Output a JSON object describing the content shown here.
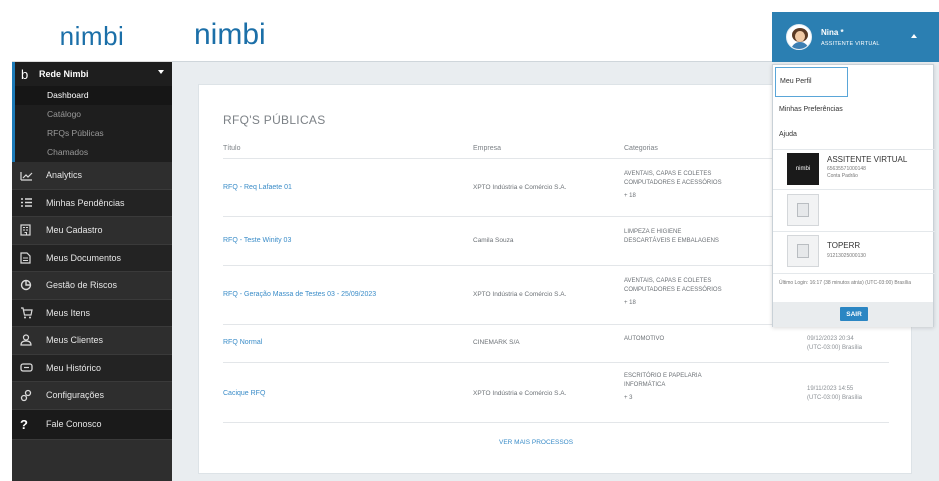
{
  "sidebar": {
    "logo_text": "nimbi",
    "group": {
      "label": "Rede Nimbi",
      "icon": "nimbi-b-icon"
    },
    "subitems": [
      "Dashboard",
      "Catálogo",
      "RFQs Públicas",
      "Chamados"
    ],
    "items": [
      {
        "label": "Analytics",
        "icon": "analytics-chart-icon"
      },
      {
        "label": "Minhas Pendências",
        "icon": "list-checks-icon"
      },
      {
        "label": "Meu Cadastro",
        "icon": "building-icon"
      },
      {
        "label": "Meus Documentos",
        "icon": "document-icon"
      },
      {
        "label": "Gestão de Riscos",
        "icon": "risk-icon"
      },
      {
        "label": "Meus Itens",
        "icon": "cart-icon"
      },
      {
        "label": "Meus Clientes",
        "icon": "users-icon"
      },
      {
        "label": "Meu Histórico",
        "icon": "history-icon"
      },
      {
        "label": "Configurações",
        "icon": "gears-icon"
      },
      {
        "label": "Fale Conosco",
        "icon": "question-icon"
      }
    ]
  },
  "header": {
    "logo_text": "nimbi",
    "user": {
      "name": "Nina *",
      "role": "ASSITENTE VIRTUAL"
    }
  },
  "main": {
    "title": "RFQ'S PÚBLICAS",
    "columns": [
      "Título",
      "Empresa",
      "Categorias"
    ],
    "rows": [
      {
        "title": "RFQ - Req Lafaete 01",
        "empresa": "XPTO Indústria e Comércio S.A.",
        "categorias": [
          "AVENTAIS, CAPAS E COLETES",
          "COMPUTADORES E ACESSÓRIOS",
          "+ 18"
        ],
        "date": ""
      },
      {
        "title": "RFQ - Teste Winity 03",
        "empresa": "Camila Souza",
        "categorias": [
          "LIMPEZA E HIGIENE",
          "DESCARTÁVEIS E EMBALAGENS"
        ],
        "date": ""
      },
      {
        "title": "RFQ - Geração Massa de Testes 03 - 25/09/2023",
        "empresa": "XPTO Indústria e Comércio S.A.",
        "categorias": [
          "AVENTAIS, CAPAS E COLETES",
          "COMPUTADORES E ACESSÓRIOS",
          "+ 18"
        ],
        "date": ""
      },
      {
        "title": "RFQ Normal",
        "empresa": "CINEMARK S/A",
        "categorias": [
          "AUTOMOTIVO"
        ],
        "date": "09/12/2023 20:34",
        "tz": "(UTC-03:00) Brasília"
      },
      {
        "title": "Cacique RFQ",
        "empresa": "XPTO Indústria e Comércio S.A.",
        "categorias": [
          "ESCRITÓRIO E PAPELARIA",
          "INFORMÁTICA",
          "+ 3"
        ],
        "date": "19/11/2023 14:55",
        "tz": "(UTC-03:00) Brasília"
      }
    ],
    "ver_mais": "VER MAIS PROCESSOS"
  },
  "dropdown": {
    "items": [
      "Meu Perfil",
      "Minhas Preferências",
      "Ajuda"
    ],
    "accounts": [
      {
        "name": "ASSITENTE VIRTUAL",
        "cnpj": "65635571000148",
        "tipo": "Conta Padrão",
        "logo": "nimbi"
      },
      {
        "name": "",
        "cnpj": "",
        "tipo": "",
        "logo": ""
      },
      {
        "name": "TOPERR",
        "cnpj": "91213025000130",
        "tipo": "",
        "logo": ""
      }
    ],
    "last_login": "Último Login: 16:17 (38 minutos atrás) (UTC-03:00) Brasília",
    "sair": "SAIR"
  }
}
